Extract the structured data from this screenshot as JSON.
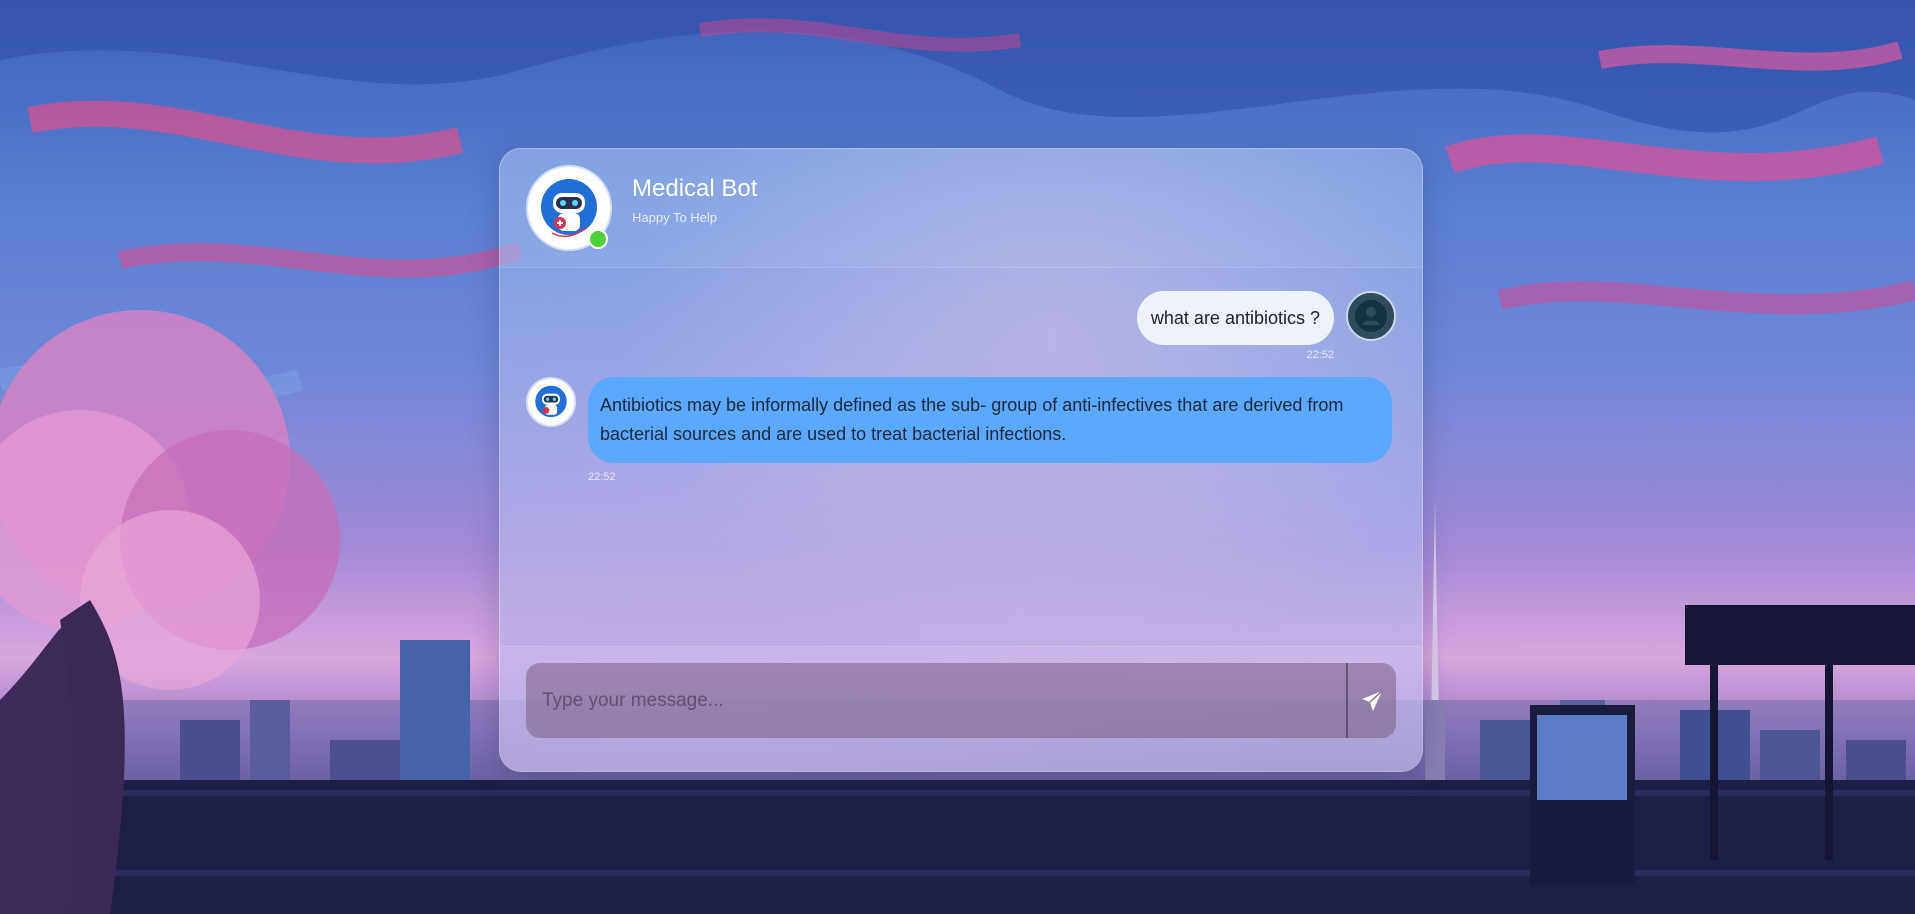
{
  "header": {
    "bot_name": "Medical Bot",
    "bot_status": "Happy To Help",
    "online_color": "#4cd137"
  },
  "messages": [
    {
      "sender": "user",
      "text": "what are antibiotics ?",
      "time": "22:52"
    },
    {
      "sender": "bot",
      "text": "Antibiotics may be informally defined as the sub- group of anti-infectives that are derived from bacterial sources and are used to treat bacterial infections.",
      "time": "22:52"
    }
  ],
  "composer": {
    "placeholder": "Type your message...",
    "send_icon": "send-paper-plane-icon"
  },
  "colors": {
    "bot_bubble": "#5aa8ff",
    "user_bubble": "#eef2fb"
  }
}
